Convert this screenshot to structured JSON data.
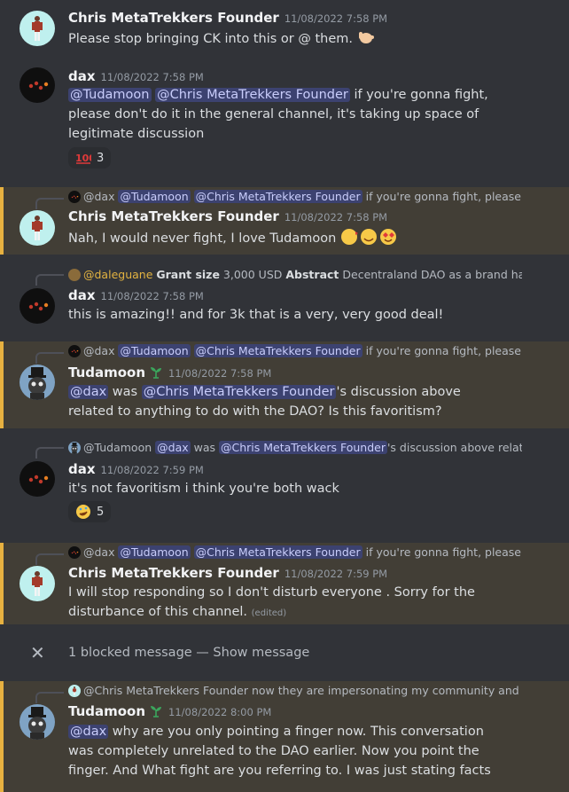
{
  "messages": [
    {
      "author": "Chris MetaTrekkers Founder",
      "timestamp": "11/08/2022 7:58 PM",
      "text": "Please stop bringing CK into this or @ them."
    },
    {
      "author": "dax",
      "timestamp": "11/08/2022 7:58 PM",
      "mention1": "@Tudamoon",
      "mention2": "@Chris MetaTrekkers Founder",
      "text": " if you're gonna fight, please don't do it in the general channel, it's taking up space of legitimate discussion",
      "reaction_count": "3"
    },
    {
      "reply_author": "@dax",
      "reply_mention1": "@Tudamoon",
      "reply_mention2": "@Chris MetaTrekkers Founder",
      "reply_text": " if you're gonna fight, please don't do it in the general channel",
      "author": "Chris MetaTrekkers Founder",
      "timestamp": "11/08/2022 7:58 PM",
      "text": "Nah, I would never fight, I love Tudamoon"
    },
    {
      "reply_author": "@daleguane",
      "reply_bold1": "Grant size",
      "reply_mid": " 3,000 USD ",
      "reply_bold2": "Abstract",
      "reply_text": " Decentraland DAO as a brand has worked",
      "author": "dax",
      "timestamp": "11/08/2022 7:58 PM",
      "text": "this is amazing!! and for 3k that is a very, very good deal!"
    },
    {
      "reply_author": "@dax",
      "reply_mention1": "@Tudamoon",
      "reply_mention2": "@Chris MetaTrekkers Founder",
      "reply_text": " if you're gonna fight, please don't do it in the general channel",
      "author": "Tudamoon",
      "timestamp": "11/08/2022 7:58 PM",
      "mention1": "@dax",
      "text1": " was ",
      "mention2": "@Chris MetaTrekkers Founder",
      "text2": "'s discussion above related to anything to do with the DAO? Is this favoritism?"
    },
    {
      "reply_author": "@Tudamoon",
      "reply_mention1": "@dax",
      "reply_mid": " was ",
      "reply_mention2": "@Chris MetaTrekkers Founder",
      "reply_text": "'s discussion above related to anything",
      "author": "dax",
      "timestamp": "11/08/2022 7:59 PM",
      "text": "it's not favoritism i think you're both wack",
      "reaction_count": "5"
    },
    {
      "reply_author": "@dax",
      "reply_mention1": "@Tudamoon",
      "reply_mention2": "@Chris MetaTrekkers Founder",
      "reply_text": " if you're gonna fight, please don't do it in the general channel",
      "author": "Chris MetaTrekkers Founder",
      "timestamp": "11/08/2022 7:59 PM",
      "text": "I will stop responding so I don't disturb everyone . Sorry for the disturbance of this channel.",
      "edited": "(edited)"
    },
    {
      "reply_author": "@Chris MetaTrekkers Founder",
      "reply_text": " now they are impersonating my community and platform",
      "author": "Tudamoon",
      "timestamp": "11/08/2022 8:00 PM",
      "mention1": "@dax",
      "text": " why are you only pointing a finger now. This conversation was completely unrelated to the DAO earlier. Now you point the finger. And What fight are you referring to. I was just stating facts"
    }
  ],
  "blocked": {
    "text": "1 blocked message —",
    "link": "Show message"
  },
  "colors": {
    "background": "#313338",
    "highlight": "#423e36",
    "highlight_border": "#e7b140",
    "mention_bg": "#3c4270",
    "mention_fg": "#c9cdfb"
  },
  "icons": {
    "close": "close-icon",
    "hundred": "hundred-points-emoji",
    "rofl": "rolling-on-floor-laughing-emoji",
    "sprout": "sprout-icon",
    "call_me": "call-me-hand-emoji"
  }
}
